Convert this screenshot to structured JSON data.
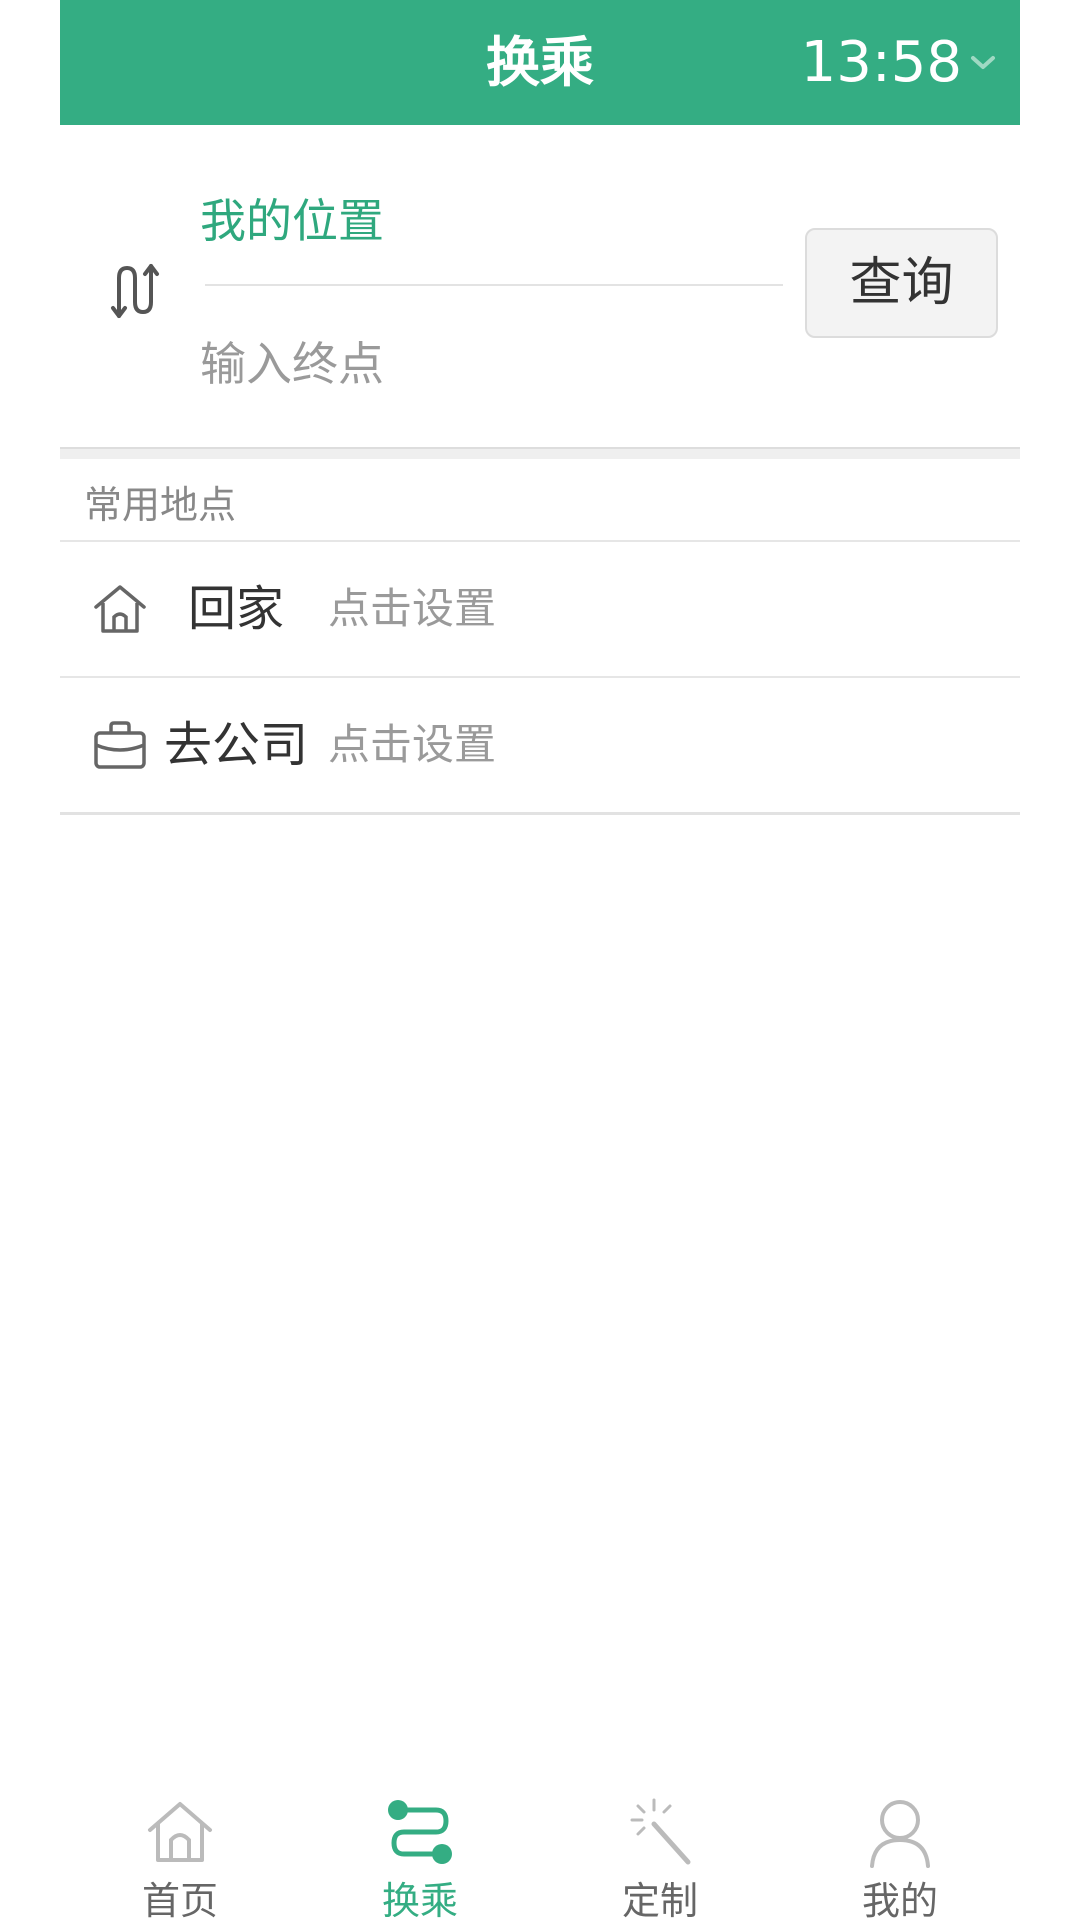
{
  "header": {
    "title": "换乘",
    "time": "13:58",
    "color": "#34ad83"
  },
  "route": {
    "origin": "我的位置",
    "destination_placeholder": "输入终点",
    "query_button": "查询"
  },
  "favorites": {
    "label": "常用地点",
    "items": [
      {
        "name": "回家",
        "hint": "点击设置",
        "icon": "home-icon"
      },
      {
        "name": "去公司",
        "hint": "点击设置",
        "icon": "briefcase-icon"
      }
    ]
  },
  "tabs": [
    {
      "label": "首页",
      "icon": "home-icon",
      "active": false
    },
    {
      "label": "换乘",
      "icon": "transfer-route-icon",
      "active": true
    },
    {
      "label": "定制",
      "icon": "magic-wand-icon",
      "active": false
    },
    {
      "label": "我的",
      "icon": "user-icon",
      "active": false
    }
  ]
}
